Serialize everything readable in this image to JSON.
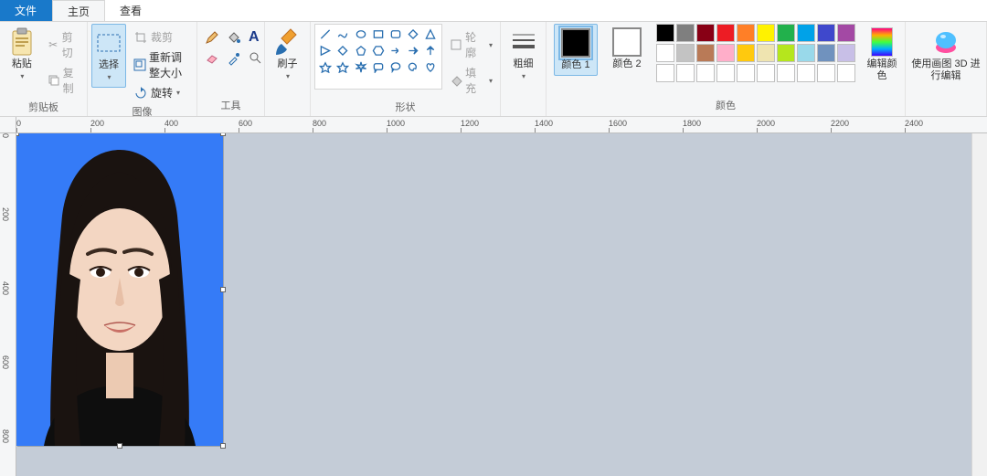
{
  "tabs": {
    "file": "文件",
    "home": "主页",
    "view": "查看"
  },
  "clipboard": {
    "paste": "粘贴",
    "cut": "剪切",
    "copy": "复制",
    "group": "剪贴板"
  },
  "image": {
    "select": "选择",
    "crop": "裁剪",
    "resize": "重新调整大小",
    "rotate": "旋转",
    "group": "图像"
  },
  "tools": {
    "group": "工具"
  },
  "brush": {
    "label": "刷子",
    "group": ""
  },
  "shapes": {
    "outline": "轮廓",
    "fill": "填充",
    "group": "形状"
  },
  "size": {
    "label": "粗细",
    "group": ""
  },
  "colors": {
    "c1": "颜色 1",
    "c2": "颜色 2",
    "palette_row1": [
      "#000000",
      "#7f7f7f",
      "#880015",
      "#ed1c24",
      "#ff7f27",
      "#fff200",
      "#22b14c",
      "#00a2e8",
      "#3f48cc",
      "#a349a4"
    ],
    "palette_row2": [
      "#ffffff",
      "#c3c3c3",
      "#b97a57",
      "#ffaec9",
      "#ffc90e",
      "#efe4b0",
      "#b5e61d",
      "#99d9ea",
      "#7092be",
      "#c8bfe7"
    ],
    "palette_row3": [
      "#ffffff",
      "#ffffff",
      "#ffffff",
      "#ffffff",
      "#ffffff",
      "#ffffff",
      "#ffffff",
      "#ffffff",
      "#ffffff",
      "#ffffff"
    ],
    "edit": "编辑颜色",
    "group": "颜色",
    "current1": "#000000",
    "current2": "#ffffff"
  },
  "p3d": {
    "label": "使用画图 3D 进行编辑"
  },
  "ruler": {
    "h": [
      "0",
      "200",
      "400",
      "600",
      "800",
      "1000",
      "1200",
      "1400",
      "1600",
      "1800",
      "2000",
      "2200",
      "2400"
    ],
    "v": [
      "0",
      "200",
      "400",
      "600",
      "800"
    ]
  },
  "image_bg": "#357bf7"
}
